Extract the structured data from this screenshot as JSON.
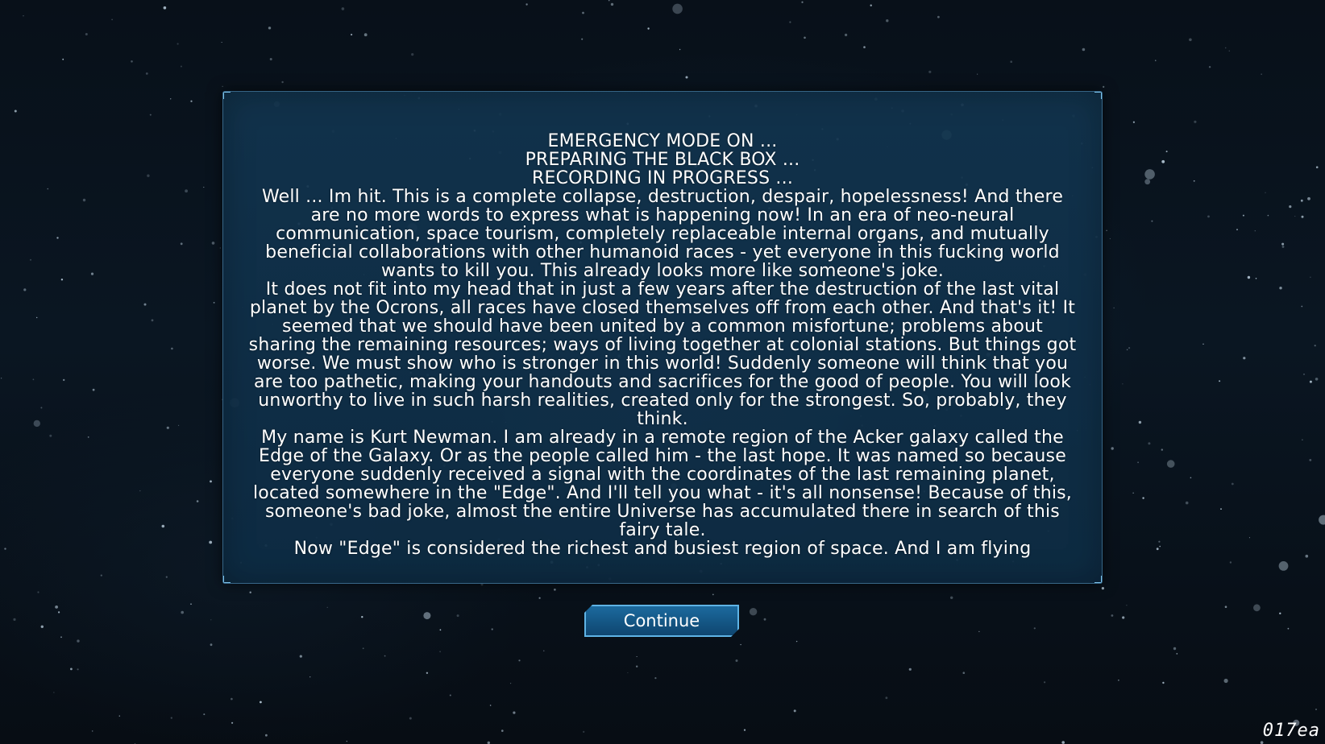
{
  "log": {
    "lines": [
      "EMERGENCY MODE ON ...",
      "PREPARING THE BLACK BOX ...",
      "RECORDING IN PROGRESS ..."
    ],
    "paragraphs": [
      "Well ... Im hit. This is a complete collapse, destruction, despair, hopelessness! And there are no more words to express what is happening now! In an era of neo-neural communication, space tourism, completely replaceable internal organs, and mutually beneficial collaborations with other humanoid races - yet everyone in this fucking world wants to kill you. This already looks more like someone's joke.",
      "It does not fit into my head that in just a few years after the destruction of the last vital planet by the Ocrons, all races have closed themselves off from each other. And that's it! It seemed that we should have been united by a common misfortune; problems about sharing the remaining resources; ways of living together at colonial stations. But things got worse. We must show who is stronger in this world! Suddenly someone will think that you are too pathetic, making your handouts and sacrifices for the good of people. You will look unworthy to live in such harsh realities, created only for the strongest. So, probably, they think.",
      "My name is Kurt Newman. I am already in a remote region of the Acker galaxy called the Edge of the Galaxy. Or as the people called him - the last hope. It was named so because everyone suddenly received a signal with the coordinates of the last remaining planet, located somewhere in the \"Edge\". And I'll tell you what - it's all nonsense! Because of this, someone's bad joke, almost the entire Universe has accumulated there in search of this fairy tale.",
      "Now \"Edge\" is considered the richest and busiest region of space. And I am flying"
    ]
  },
  "continue_button": {
    "label": "Continue"
  },
  "version_tag": "017ea",
  "colors": {
    "panel": "#12344e",
    "panel_border": "#5a96be",
    "button": "#1c6a9e",
    "button_border": "#5fb4e6",
    "text": "#ffffff"
  }
}
